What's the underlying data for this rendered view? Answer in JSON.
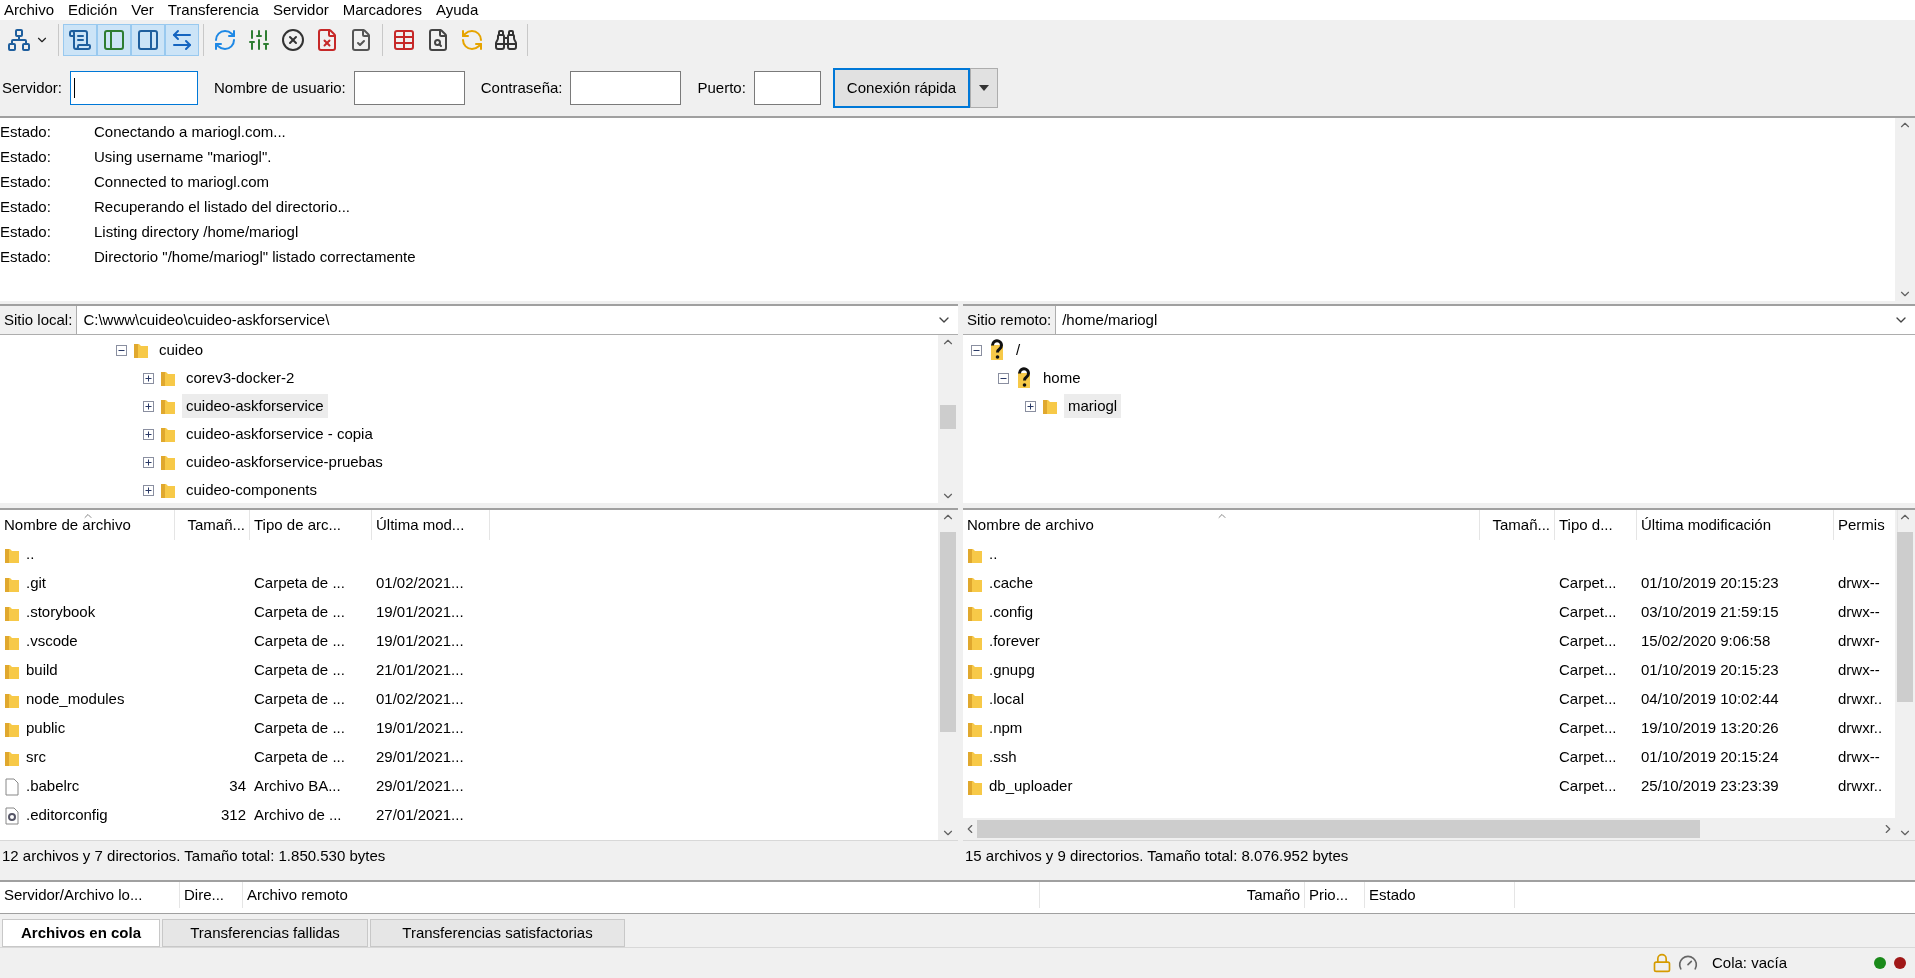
{
  "menu": [
    "Archivo",
    "Edición",
    "Ver",
    "Transferencia",
    "Servidor",
    "Marcadores",
    "Ayuda"
  ],
  "toolbar": [
    [
      {
        "kind": "site-manager",
        "on": false
      }
    ],
    [
      {
        "kind": "message-log",
        "on": true
      },
      {
        "kind": "local-tree",
        "on": true
      },
      {
        "kind": "remote-tree",
        "on": true
      },
      {
        "kind": "transfer-queue",
        "on": true
      }
    ],
    [
      {
        "kind": "refresh",
        "on": false
      },
      {
        "kind": "filter",
        "on": false
      },
      {
        "kind": "cancel",
        "on": false
      },
      {
        "kind": "disconnect",
        "on": false
      },
      {
        "kind": "reconnect",
        "on": false
      }
    ],
    [
      {
        "kind": "compare",
        "on": false
      },
      {
        "kind": "search",
        "on": false
      },
      {
        "kind": "sync",
        "on": false
      },
      {
        "kind": "find",
        "on": false
      }
    ]
  ],
  "quickconnect": {
    "fields": [
      {
        "label": "Servidor:",
        "focused": true
      },
      {
        "label": "Nombre de usuario:",
        "focused": false
      },
      {
        "label": "Contraseña:",
        "focused": false
      },
      {
        "label": "Puerto:",
        "focused": false
      }
    ],
    "button": "Conexión rápida"
  },
  "log": [
    {
      "label": "Estado:",
      "text": "Conectando a mariogl.com..."
    },
    {
      "label": "Estado:",
      "text": "Using username \"mariogl\"."
    },
    {
      "label": "Estado:",
      "text": "Connected to mariogl.com"
    },
    {
      "label": "Estado:",
      "text": "Recuperando el listado del directorio..."
    },
    {
      "label": "Estado:",
      "text": "Listing directory /home/mariogl"
    },
    {
      "label": "Estado:",
      "text": "Directorio \"/home/mariogl\" listado correctamente"
    }
  ],
  "local": {
    "site_label": "Sitio local:",
    "path": "C:\\www\\cuideo\\cuideo-askforservice\\",
    "tree": [
      {
        "label": "cuideo",
        "kind": "folder",
        "expanded": true,
        "selected": false,
        "children": [
          {
            "label": "corev3-docker-2",
            "kind": "folder",
            "expanded": false,
            "selected": false
          },
          {
            "label": "cuideo-askforservice",
            "kind": "folder",
            "expanded": false,
            "selected": true
          },
          {
            "label": "cuideo-askforservice - copia",
            "kind": "folder",
            "expanded": false,
            "selected": false
          },
          {
            "label": "cuideo-askforservice-pruebas",
            "kind": "folder",
            "expanded": false,
            "selected": false
          },
          {
            "label": "cuideo-components",
            "kind": "folder",
            "expanded": false,
            "selected": false
          }
        ]
      }
    ],
    "columns": [
      {
        "label": "Nombre de archivo",
        "sorted": true
      },
      {
        "label": "Tamañ...",
        "sorted": false
      },
      {
        "label": "Tipo de arc...",
        "sorted": false
      },
      {
        "label": "Última mod...",
        "sorted": false
      }
    ],
    "rows": [
      {
        "kind": "folder",
        "name": ".."
      },
      {
        "kind": "folder",
        "name": ".git",
        "type": "Carpeta de ...",
        "modified": "01/02/2021..."
      },
      {
        "kind": "folder",
        "name": ".storybook",
        "type": "Carpeta de ...",
        "modified": "19/01/2021..."
      },
      {
        "kind": "folder",
        "name": ".vscode",
        "type": "Carpeta de ...",
        "modified": "19/01/2021..."
      },
      {
        "kind": "folder",
        "name": "build",
        "type": "Carpeta de ...",
        "modified": "21/01/2021..."
      },
      {
        "kind": "folder",
        "name": "node_modules",
        "type": "Carpeta de ...",
        "modified": "01/02/2021..."
      },
      {
        "kind": "folder",
        "name": "public",
        "type": "Carpeta de ...",
        "modified": "19/01/2021..."
      },
      {
        "kind": "folder",
        "name": "src",
        "type": "Carpeta de ...",
        "modified": "29/01/2021..."
      },
      {
        "kind": "file",
        "name": ".babelrc",
        "size": "34",
        "type": "Archivo BA...",
        "modified": "29/01/2021..."
      },
      {
        "kind": "config",
        "name": ".editorconfig",
        "size": "312",
        "type": "Archivo de ...",
        "modified": "27/01/2021..."
      }
    ],
    "summary": "12 archivos y 7 directorios. Tamaño total: 1.850.530 bytes"
  },
  "remote": {
    "site_label": "Sitio remoto:",
    "path": "/home/mariogl",
    "tree": [
      {
        "label": "/",
        "kind": "unknown",
        "expanded": true,
        "selected": false,
        "children": [
          {
            "label": "home",
            "kind": "unknown",
            "expanded": true,
            "selected": false,
            "children": [
              {
                "label": "mariogl",
                "kind": "folder",
                "expanded": false,
                "selected": true
              }
            ]
          }
        ]
      }
    ],
    "columns": [
      {
        "label": "Nombre de archivo",
        "sorted": true
      },
      {
        "label": "Tamañ...",
        "sorted": false
      },
      {
        "label": "Tipo d...",
        "sorted": false
      },
      {
        "label": "Última modificación",
        "sorted": false
      },
      {
        "label": "Permis",
        "sorted": false
      }
    ],
    "rows": [
      {
        "kind": "folder",
        "name": ".."
      },
      {
        "kind": "folder",
        "name": ".cache",
        "type": "Carpet...",
        "modified": "01/10/2019 20:15:23",
        "perms": "drwx--"
      },
      {
        "kind": "folder",
        "name": ".config",
        "type": "Carpet...",
        "modified": "03/10/2019 21:59:15",
        "perms": "drwx--"
      },
      {
        "kind": "folder",
        "name": ".forever",
        "type": "Carpet...",
        "modified": "15/02/2020 9:06:58",
        "perms": "drwxr-"
      },
      {
        "kind": "folder",
        "name": ".gnupg",
        "type": "Carpet...",
        "modified": "01/10/2019 20:15:23",
        "perms": "drwx--"
      },
      {
        "kind": "folder",
        "name": ".local",
        "type": "Carpet...",
        "modified": "04/10/2019 10:02:44",
        "perms": "drwxr.."
      },
      {
        "kind": "folder",
        "name": ".npm",
        "type": "Carpet...",
        "modified": "19/10/2019 13:20:26",
        "perms": "drwxr.."
      },
      {
        "kind": "folder",
        "name": ".ssh",
        "type": "Carpet...",
        "modified": "01/10/2019 20:15:24",
        "perms": "drwx--"
      },
      {
        "kind": "folder",
        "name": "db_uploader",
        "type": "Carpet...",
        "modified": "25/10/2019 23:23:39",
        "perms": "drwxr.."
      }
    ],
    "summary": "15 archivos y 9 directorios. Tamaño total: 8.076.952 bytes"
  },
  "queue": {
    "columns": [
      "Servidor/Archivo lo...",
      "Dire...",
      "Archivo remoto",
      "Tamaño",
      "Prio...",
      "Estado"
    ]
  },
  "queue_tabs": [
    {
      "label": "Archivos en cola",
      "selected": true
    },
    {
      "label": "Transferencias fallidas",
      "selected": false
    },
    {
      "label": "Transferencias satisfactorias",
      "selected": false
    }
  ],
  "status_bar": {
    "queue": "Cola: vacía"
  }
}
